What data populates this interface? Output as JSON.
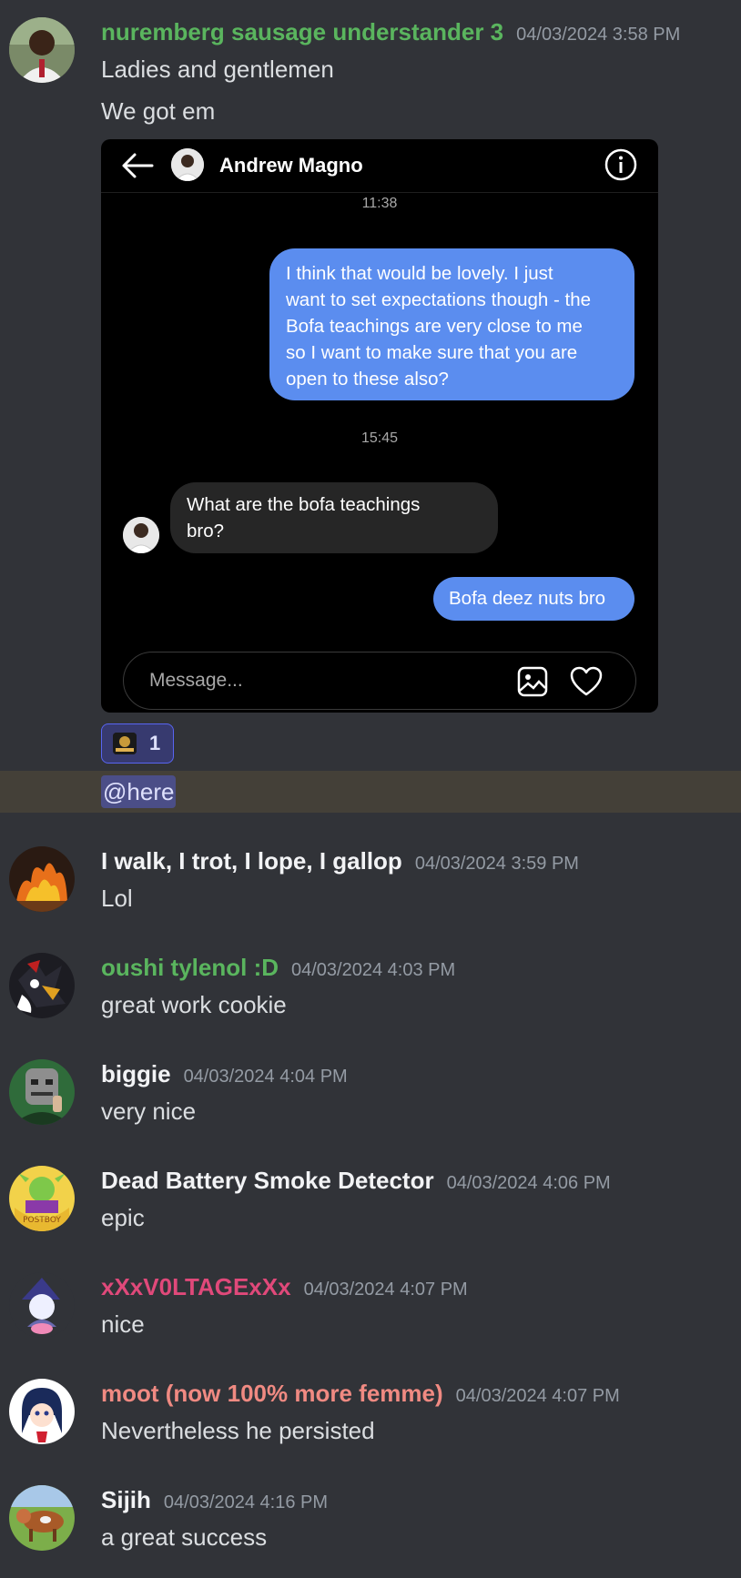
{
  "colors": {
    "bg": "#313338",
    "green": "#5ab55e",
    "pink": "#e0497a",
    "salmon": "#f08a82",
    "white": "#f2f3f5",
    "mention_bg": "#4b4e87",
    "bubble_out": "#5b8def",
    "bubble_in": "#262626"
  },
  "first_message": {
    "author": "nuremberg sausage understander 3",
    "timestamp": "04/03/2024 3:58 PM",
    "lines": [
      "Ladies and gentlemen",
      "We got em"
    ],
    "embed": {
      "contact_name": "Andrew Magno",
      "time1": "11:38",
      "bubble_out_1": "I think that would be lovely. I just\nwant to set expectations though - the\nBofa teachings are very close to me\nso I want to make sure that you are\nopen to these also?",
      "time2": "15:45",
      "bubble_in_1": "What are the bofa teachings\nbro?",
      "bubble_out_2": "Bofa deez nuts bro",
      "composer_placeholder": "Message...",
      "icons": [
        "back-arrow-icon",
        "info-icon",
        "gallery-icon",
        "heart-icon"
      ]
    },
    "reaction": {
      "count": "1"
    },
    "mention": "@here"
  },
  "messages": [
    {
      "author": "I walk, I trot, I lope, I gallop",
      "timestamp": "04/03/2024 3:59 PM",
      "text": "Lol"
    },
    {
      "author": "oushi tylenol :D",
      "timestamp": "04/03/2024 4:03 PM",
      "text": "great work cookie"
    },
    {
      "author": "biggie",
      "timestamp": "04/03/2024 4:04 PM",
      "text": "very nice"
    },
    {
      "author": "Dead Battery Smoke Detector",
      "timestamp": "04/03/2024 4:06 PM",
      "text": "epic"
    },
    {
      "author": "xXxV0LTAGExXx",
      "timestamp": "04/03/2024 4:07 PM",
      "text": "nice"
    },
    {
      "author": "moot (now 100% more femme)",
      "timestamp": "04/03/2024 4:07 PM",
      "text": "Nevertheless he persisted"
    },
    {
      "author": "Sijih",
      "timestamp": "04/03/2024 4:16 PM",
      "text": "a great success"
    }
  ]
}
